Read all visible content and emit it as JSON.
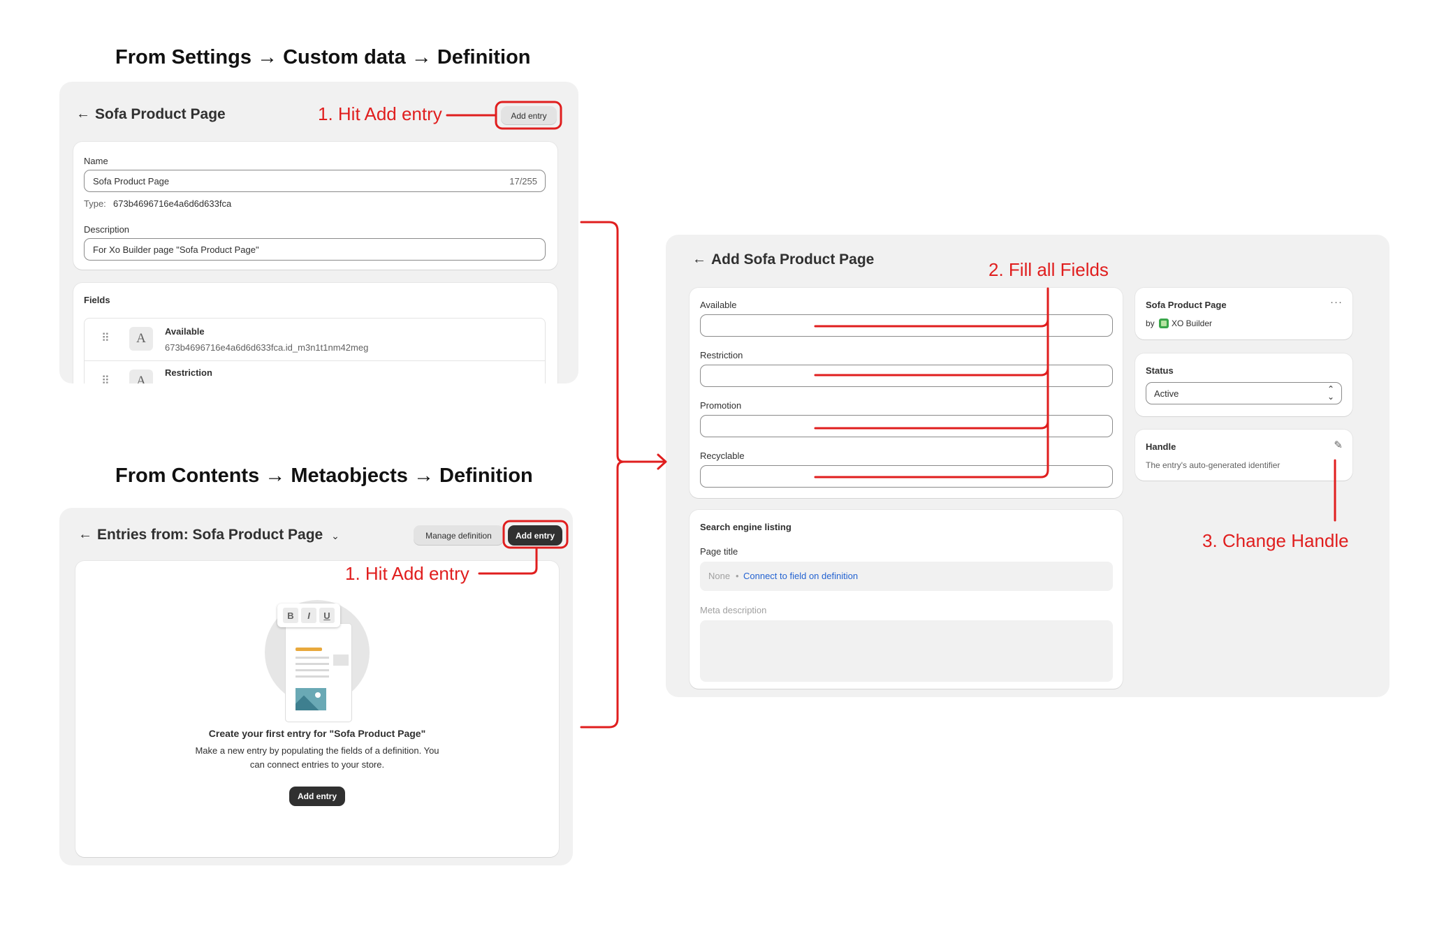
{
  "headings": {
    "settings_path": "From Settings → Custom data → Definition",
    "contents_path": "From Contents → Metaobjects → Definition"
  },
  "annotations": {
    "step1_a": "1. Hit Add entry",
    "step1_b": "1. Hit Add entry",
    "step2": "2. Fill all Fields",
    "step3": "3. Change Handle"
  },
  "definition_page": {
    "title": "Sofa Product Page",
    "add_entry_label": "Add entry",
    "name_label": "Name",
    "name_value": "Sofa Product Page",
    "name_counter": "17/255",
    "type_label": "Type:",
    "type_value": "673b4696716e4a6d6d633fca",
    "description_label": "Description",
    "description_value": "For Xo Builder page \"Sofa Product Page\"",
    "fields_label": "Fields",
    "fields": [
      {
        "name": "Available",
        "key": "673b4696716e4a6d6d633fca.id_m3n1t1nm42meg",
        "type_icon": "A"
      },
      {
        "name": "Restriction",
        "key": "",
        "type_icon": "A"
      }
    ]
  },
  "entries_page": {
    "title_prefix": "Entries from:",
    "title_name": "Sofa Product Page",
    "manage_label": "Manage definition",
    "add_entry_label": "Add entry",
    "format_buttons": [
      "B",
      "I",
      "U"
    ],
    "empty_title": "Create your first entry for \"Sofa Product Page\"",
    "empty_text_line1": "Make a new entry by populating the fields of a definition. You",
    "empty_text_line2": "can connect entries to your store.",
    "empty_button": "Add entry"
  },
  "add_entry_page": {
    "title": "Add Sofa Product Page",
    "fields": [
      "Available",
      "Restriction",
      "Promotion",
      "Recyclable"
    ],
    "seo": {
      "title": "Search engine listing",
      "page_title_label": "Page title",
      "page_title_none": "None",
      "page_title_link": "Connect to field on definition",
      "meta_label": "Meta description"
    },
    "sidebar": {
      "definition_name": "Sofa Product Page",
      "by_label": "by",
      "app_name": "XO Builder",
      "status_label": "Status",
      "status_value": "Active",
      "handle_label": "Handle",
      "handle_text": "The entry's auto-generated identifier"
    }
  },
  "colors": {
    "annotation": "#e01e1e",
    "panel_bg": "#f1f1f1",
    "primary_button": "#303030",
    "link": "#2463d1"
  }
}
